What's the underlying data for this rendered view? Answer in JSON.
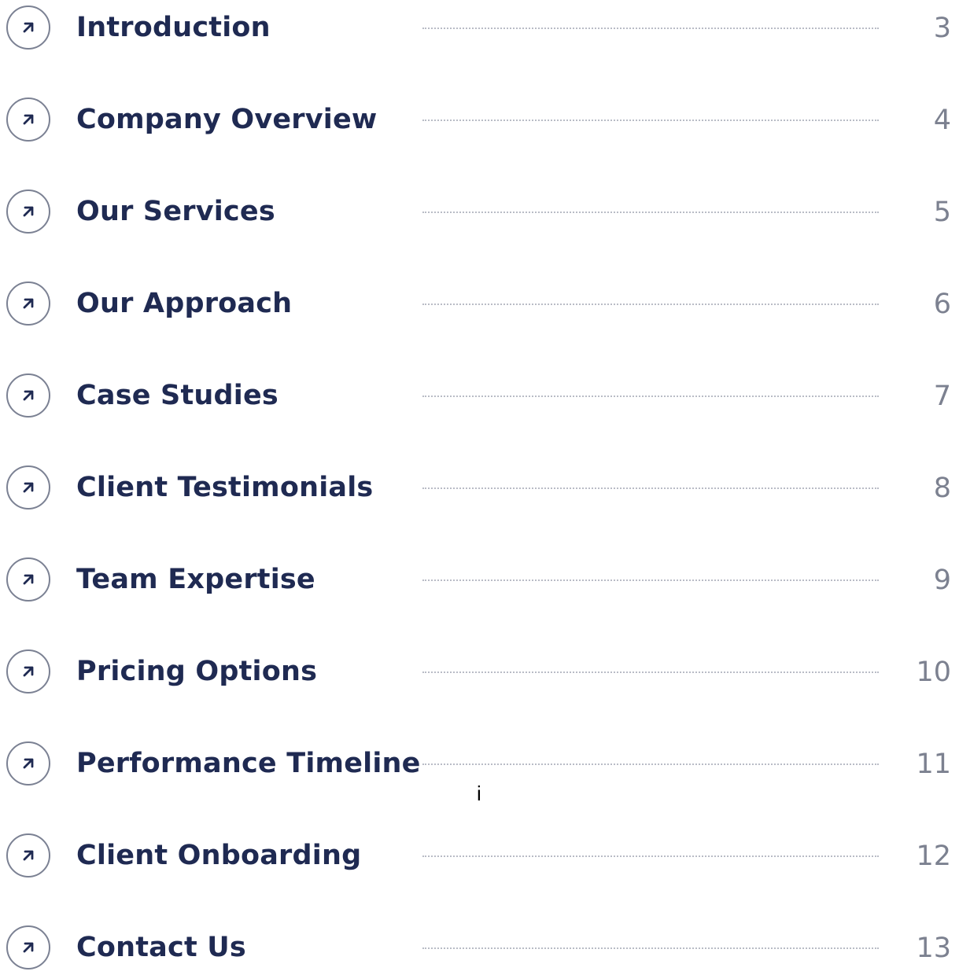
{
  "toc": {
    "entries": [
      {
        "title": "Introduction",
        "page": "3"
      },
      {
        "title": "Company Overview",
        "page": "4"
      },
      {
        "title": "Our Services",
        "page": "5"
      },
      {
        "title": "Our Approach",
        "page": "6"
      },
      {
        "title": "Case Studies",
        "page": "7"
      },
      {
        "title": "Client Testimonials",
        "page": "8"
      },
      {
        "title": "Team Expertise",
        "page": "9"
      },
      {
        "title": "Pricing Options",
        "page": "10"
      },
      {
        "title": "Performance Timeline",
        "page": "11"
      },
      {
        "title": "Client Onboarding",
        "page": "12"
      },
      {
        "title": "Contact Us",
        "page": "13"
      }
    ],
    "stray_mark": "i"
  },
  "colors": {
    "title": "#1f2a52",
    "page_number": "#7c8190",
    "leader_dots": "#b9bcc6",
    "icon_border": "#7b8193"
  },
  "icons": {
    "entry_icon": "arrow-up-right-icon"
  }
}
